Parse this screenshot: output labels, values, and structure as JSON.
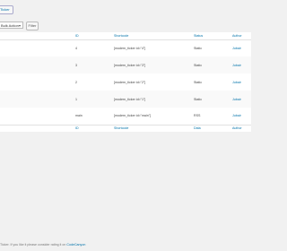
{
  "toolbar": {
    "add_new_label": "Ticker"
  },
  "filters": {
    "bulk_action": "Bulk Action",
    "filter_label": "Filter"
  },
  "table": {
    "headers": {
      "id": "ID",
      "shortcode": "Shortcode",
      "status": "Status",
      "author": "Author"
    },
    "rows": [
      {
        "id": "4",
        "shortcode": "[modern_ticker id=\"4\"]",
        "status": "Static",
        "author": "Jubair"
      },
      {
        "id": "3",
        "shortcode": "[modern_ticker id=\"3\"]",
        "status": "Static",
        "author": "Jubair"
      },
      {
        "id": "2",
        "shortcode": "[modern_ticker id=\"2\"]",
        "status": "Static",
        "author": "Jubair"
      },
      {
        "id": "1",
        "shortcode": "[modern_ticker id=\"1\"]",
        "status": "Static",
        "author": "Jubair"
      },
      {
        "id": "main",
        "shortcode": "[modern_ticker id=\"main\"]",
        "status": "RSS",
        "author": "Jubair"
      }
    ],
    "footer_headers": {
      "id": "ID",
      "shortcode": "Shortcode",
      "status": "Data",
      "author": "Author"
    }
  },
  "footer": {
    "text": "Ticker. If you like it please consider rating it on ",
    "link": "CodeCanyon"
  }
}
